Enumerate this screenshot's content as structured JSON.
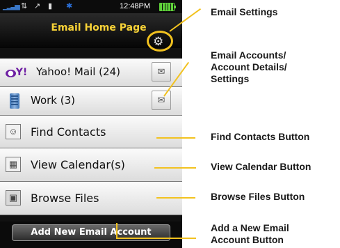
{
  "status_bar": {
    "signal_icon": "signal-bars-icon",
    "time": "12:48PM",
    "icons": [
      "data-arrows-icon",
      "roaming-icon",
      "vibrate-icon",
      "bluetooth-icon",
      "battery-icon"
    ]
  },
  "header": {
    "title": "Email Home Page",
    "settings_icon": "gears-icon"
  },
  "accounts": [
    {
      "icon_text": "Y!",
      "label": "Yahoo! Mail (24)"
    },
    {
      "label": "Work (3)"
    }
  ],
  "actions": [
    {
      "label": "Find Contacts",
      "icon": "contacts-icon"
    },
    {
      "label": "View Calendar(s)",
      "icon": "calendar-icon"
    },
    {
      "label": "Browse Files",
      "icon": "file-icon"
    }
  ],
  "add_button": {
    "label": "Add New Email Account"
  },
  "callouts": {
    "email_settings": "Email Settings",
    "accounts": [
      "Email Accounts/",
      "Account Details/",
      "Settings"
    ],
    "find_contacts": "Find Contacts Button",
    "view_calendar": "View Calendar Button",
    "browse_files": "Browse Files Button",
    "add_account": [
      "Add a New Email",
      "Account Button"
    ]
  },
  "colors": {
    "accent": "#f2c21f",
    "title_text": "#f7d237",
    "yahoo_purple": "#6e1fa3"
  }
}
